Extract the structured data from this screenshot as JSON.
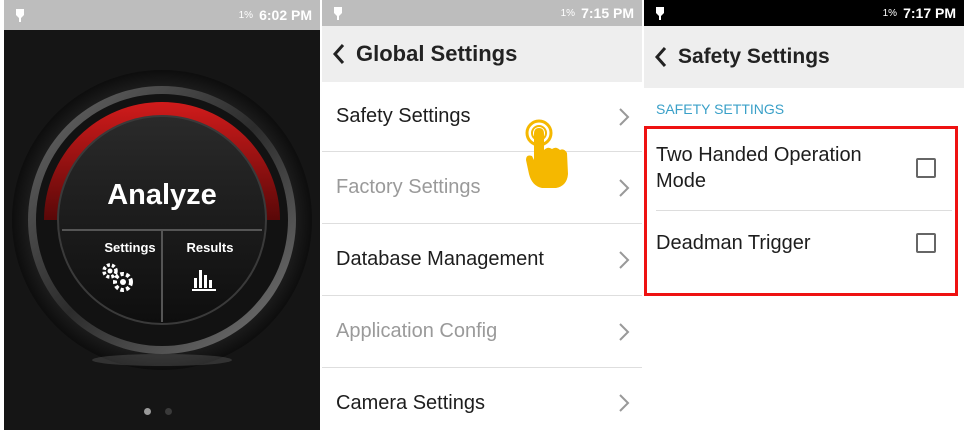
{
  "panel_home": {
    "status": {
      "battery": "1%",
      "time": "6:02 PM"
    },
    "dial": {
      "main_label": "Analyze",
      "settings_label": "Settings",
      "results_label": "Results"
    },
    "pager": {
      "active_index": 0,
      "count": 2
    }
  },
  "panel_global": {
    "status": {
      "battery": "1%",
      "time": "7:15 PM"
    },
    "title": "Global Settings",
    "items": [
      {
        "label": "Safety Settings",
        "enabled": true
      },
      {
        "label": "Factory Settings",
        "enabled": false
      },
      {
        "label": "Database Management",
        "enabled": true
      },
      {
        "label": "Application Config",
        "enabled": false
      },
      {
        "label": "Camera Settings",
        "enabled": true
      }
    ]
  },
  "panel_safety": {
    "status": {
      "battery": "1%",
      "time": "7:17 PM"
    },
    "title": "Safety Settings",
    "section_header": "SAFETY SETTINGS",
    "options": [
      {
        "label_line1": "Two Handed Operation",
        "label_line2": "Mode",
        "checked": false
      },
      {
        "label_line1": "Deadman Trigger",
        "label_line2": "",
        "checked": false
      }
    ]
  },
  "colors": {
    "accent_red": "#ee1111",
    "section_blue": "#3aa0c8",
    "disabled_text": "#9a9a9a",
    "enabled_text": "#1d1d1d",
    "tap_hand": "#f5b800"
  },
  "icons": {
    "status_left": "usb-icon",
    "back": "back-arrow-icon",
    "chevron": "chevron-right-icon",
    "settings": "gears-icon",
    "results": "bar-chart-icon",
    "tap": "tap-hand-icon"
  }
}
